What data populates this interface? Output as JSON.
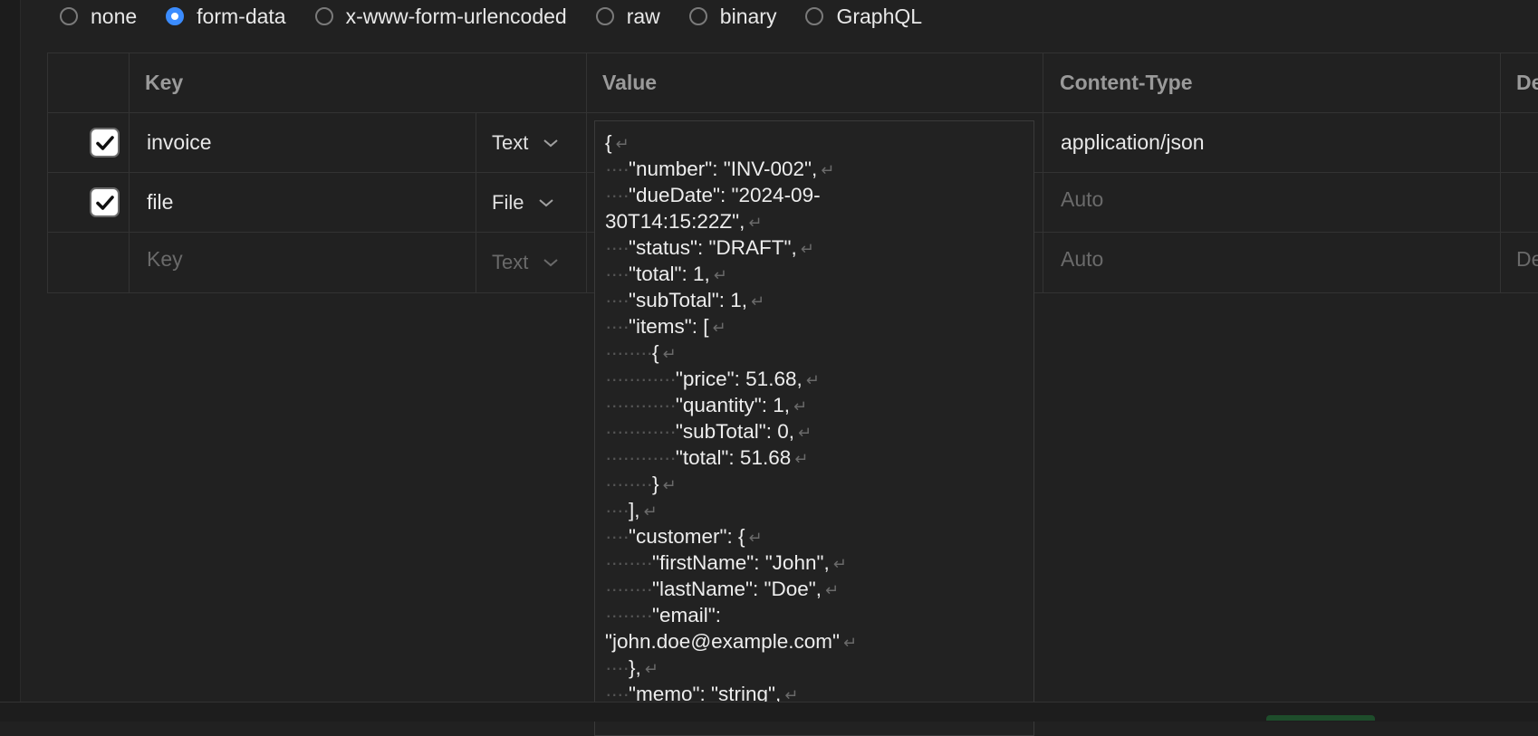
{
  "body_types": [
    {
      "label": "none",
      "selected": false
    },
    {
      "label": "form-data",
      "selected": true
    },
    {
      "label": "x-www-form-urlencoded",
      "selected": false
    },
    {
      "label": "raw",
      "selected": false
    },
    {
      "label": "binary",
      "selected": false
    },
    {
      "label": "GraphQL",
      "selected": false
    }
  ],
  "table": {
    "headers": {
      "key": "Key",
      "value": "Value",
      "content_type": "Content-Type",
      "description": "De"
    },
    "rows": [
      {
        "checked": true,
        "key": "invoice",
        "type": "Text",
        "content_type": "application/json"
      },
      {
        "checked": true,
        "key": "file",
        "type": "File",
        "content_type_placeholder": "Auto"
      },
      {
        "checked": false,
        "key_placeholder": "Key",
        "type": "Text",
        "content_type_placeholder": "Auto",
        "description_placeholder": "De"
      }
    ]
  },
  "editor": {
    "lines": [
      {
        "indent": 0,
        "text": "{"
      },
      {
        "indent": 4,
        "text": "\"number\": \"INV-002\","
      },
      {
        "indent": 4,
        "text": "\"dueDate\": \"2024-09-",
        "nl": false
      },
      {
        "indent": 0,
        "text": "30T14:15:22Z\","
      },
      {
        "indent": 4,
        "text": "\"status\": \"DRAFT\","
      },
      {
        "indent": 4,
        "text": "\"total\": 1,"
      },
      {
        "indent": 4,
        "text": "\"subTotal\": 1,"
      },
      {
        "indent": 4,
        "text": "\"items\": ["
      },
      {
        "indent": 8,
        "text": "{"
      },
      {
        "indent": 12,
        "text": "\"price\": 51.68,"
      },
      {
        "indent": 12,
        "text": "\"quantity\": 1,"
      },
      {
        "indent": 12,
        "text": "\"subTotal\": 0,"
      },
      {
        "indent": 12,
        "text": "\"total\": 51.68"
      },
      {
        "indent": 8,
        "text": "}"
      },
      {
        "indent": 4,
        "text": "],"
      },
      {
        "indent": 4,
        "text": "\"customer\": {"
      },
      {
        "indent": 8,
        "text": "\"firstName\": \"John\","
      },
      {
        "indent": 8,
        "text": "\"lastName\": \"Doe\","
      },
      {
        "indent": 8,
        "text": "\"email\":",
        "nl": false
      },
      {
        "indent": 0,
        "text": "\"john.doe@example.com\""
      },
      {
        "indent": 4,
        "text": "},"
      },
      {
        "indent": 4,
        "text": "\"memo\": \"string\","
      }
    ]
  }
}
